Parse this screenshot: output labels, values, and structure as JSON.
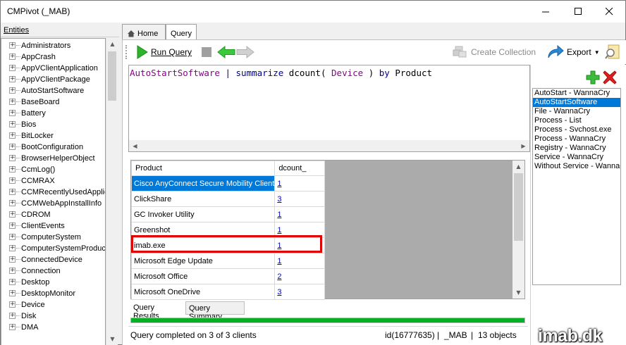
{
  "window": {
    "title": "CMPivot (_MAB)"
  },
  "entities": {
    "header": "Entities",
    "items": [
      "Administrators",
      "AppCrash",
      "AppVClientApplication",
      "AppVClientPackage",
      "AutoStartSoftware",
      "BaseBoard",
      "Battery",
      "Bios",
      "BitLocker",
      "BootConfiguration",
      "BrowserHelperObject",
      "CcmLog()",
      "CCMRAX",
      "CCMRecentlyUsedApplic",
      "CCMWebAppInstallInfo",
      "CDROM",
      "ClientEvents",
      "ComputerSystem",
      "ComputerSystemProduct",
      "ConnectedDevice",
      "Connection",
      "Desktop",
      "DesktopMonitor",
      "Device",
      "Disk",
      "DMA"
    ]
  },
  "tabs": {
    "home": "Home",
    "query": "Query"
  },
  "toolbar": {
    "run_query": "Run Query",
    "create_collection": "Create Collection",
    "export": "Export"
  },
  "query": {
    "table": "AutoStartSoftware",
    "pipe": "|",
    "op": "summarize",
    "fn": "dcount(",
    "arg": "Device",
    "close": ")",
    "by": "by",
    "group": "Product"
  },
  "saved_queries": [
    "AutoStart - WannaCry",
    "AutoStartSoftware",
    "File - WannaCry",
    "Process - List",
    "Process - Svchost.exe",
    "Process - WannaCry",
    "Registry - WannaCry",
    "Service - WannaCry",
    "Without Service - WannaC"
  ],
  "grid": {
    "columns": [
      "Product",
      "dcount_"
    ],
    "rows": [
      {
        "product": "Cisco AnyConnect Secure Mobility Client",
        "count": "1"
      },
      {
        "product": "ClickShare",
        "count": "3"
      },
      {
        "product": "GC Invoker Utility",
        "count": "1"
      },
      {
        "product": "Greenshot",
        "count": "1"
      },
      {
        "product": "imab.exe",
        "count": "1"
      },
      {
        "product": "Microsoft Edge Update",
        "count": "1"
      },
      {
        "product": "Microsoft Office",
        "count": "2"
      },
      {
        "product": "Microsoft OneDrive",
        "count": "3"
      }
    ]
  },
  "result_tabs": {
    "results": "Query Results",
    "summary": "Query Summary"
  },
  "status": {
    "message": "Query completed on 3 of 3 clients",
    "id": "id(16777635)",
    "site": "_MAB",
    "objects": "13 objects",
    "sep": "|"
  },
  "watermark": "imab.dk",
  "colors": {
    "accent": "#0078d7",
    "progress": "#06b025",
    "highlight": "#e00000"
  }
}
